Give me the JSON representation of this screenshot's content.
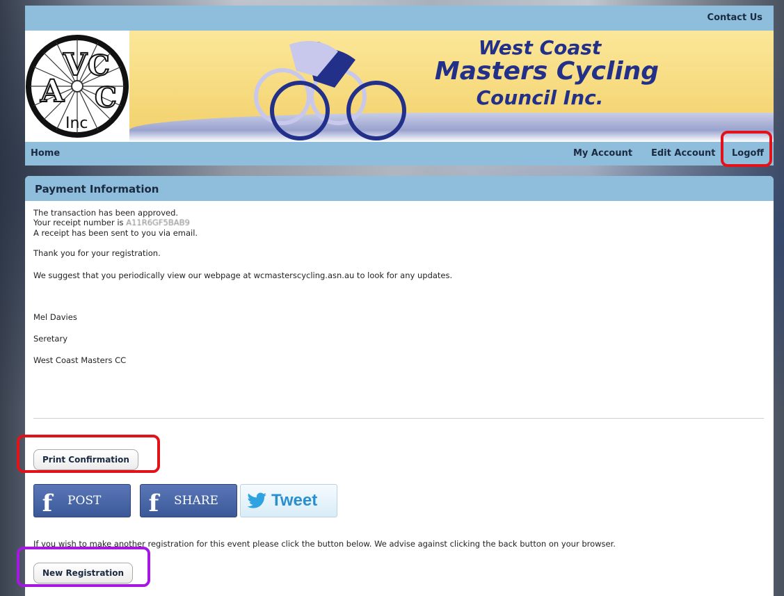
{
  "header": {
    "contact_label": "Contact Us",
    "logo_letters": {
      "a": "A",
      "v": "V",
      "c1": "C",
      "c2": "C",
      "inc": "Inc"
    },
    "title_lines": [
      "West Coast",
      "Masters Cycling",
      "Council Inc."
    ]
  },
  "nav": {
    "home": "Home",
    "my_account": "My Account",
    "edit_account": "Edit Account",
    "logoff": "Logoff"
  },
  "panel": {
    "title": "Payment Information",
    "lines": {
      "approved": "The transaction has been approved.",
      "receipt_prefix": "Your receipt number is",
      "receipt_number": "A11R6GF5BAB9",
      "emailed": "A receipt has been sent to you via email.",
      "thanks": "Thank you for your registration.",
      "suggest": "We suggest that you periodically view our webpage at wcmasterscycling.asn.au to look for any updates.",
      "signer_name": "Mel Davies",
      "signer_title": "Seretary",
      "signer_org": "West Coast Masters CC",
      "another": "If you wish to make another registration for this event please click the button below. We advise against clicking the back button on your browser."
    },
    "print_label": "Print Confirmation",
    "new_registration_label": "New Registration"
  },
  "social": {
    "post_label": "POST",
    "share_label": "SHARE",
    "tweet_label": "Tweet",
    "fb_glyph": "f"
  },
  "colors": {
    "nav_blue": "#8fbedc",
    "title_navy": "#22308a",
    "highlight_red": "#e2121b",
    "highlight_purple": "#a418e0",
    "facebook_blue": "#3b5998",
    "twitter_blue": "#2ea3e0"
  },
  "icons": {
    "twitter": "twitter-bird-icon",
    "facebook": "facebook-f-icon"
  }
}
